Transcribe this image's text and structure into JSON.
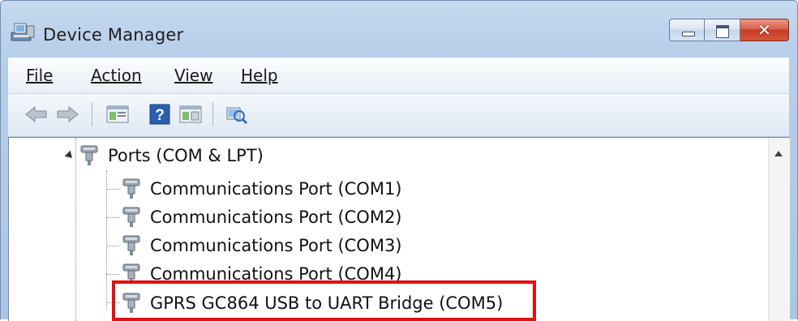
{
  "window": {
    "title": "Device Manager",
    "buttons": {
      "minimize": "minimize",
      "maximize": "maximize",
      "close": "close"
    },
    "close_glyph": "✕"
  },
  "menu": [
    {
      "label": "File"
    },
    {
      "label": "Action"
    },
    {
      "label": "View"
    },
    {
      "label": "Help"
    }
  ],
  "toolbar": {
    "icons": [
      "back-icon",
      "forward-icon",
      "properties-icon",
      "help-icon",
      "details-icon",
      "scan-hardware-icon"
    ]
  },
  "tree": {
    "category": {
      "label": "Ports (COM & LPT)",
      "expanded": true
    },
    "items": [
      {
        "label": "Communications Port (COM1)"
      },
      {
        "label": "Communications Port (COM2)"
      },
      {
        "label": "Communications Port (COM3)"
      },
      {
        "label": "Communications Port (COM4)"
      },
      {
        "label": "GPRS GC864 USB to UART Bridge (COM5)",
        "highlighted": true
      }
    ]
  },
  "colors": {
    "highlight_border": "#e01010",
    "titlebar": "#b8cfea",
    "close_button": "#c63d24"
  }
}
